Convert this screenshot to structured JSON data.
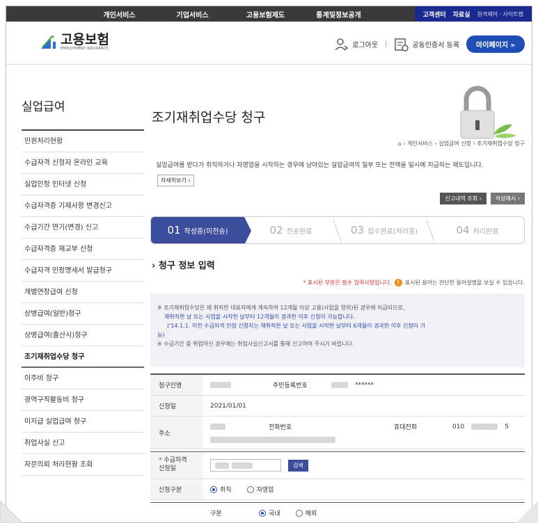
{
  "topnav": {
    "items": [
      "개인서비스",
      "기업서비스",
      "고용보험제도",
      "통계및정보공개"
    ],
    "customer_center": "고객센터",
    "library": "자료실",
    "links": "원격제어 · 사이트맵"
  },
  "header": {
    "logo_title": "고용보험",
    "logo_sub": "EMPLOYMENT INSURANCE",
    "logout": "로그아웃",
    "separator": "|",
    "cert_register": "공동인증서 등록",
    "mypage": "마이페이지  »"
  },
  "sidebar": {
    "title": "실업급여",
    "items": [
      {
        "label": "민원처리현황"
      },
      {
        "label": "수급자격 신청자 온라인 교육"
      },
      {
        "label": "실업인정 인터넷 신청"
      },
      {
        "label": "수급자격증 기재사항 변경신고"
      },
      {
        "label": "수급기간 연기(변경) 신고"
      },
      {
        "label": "수급자격증 재교부 신청"
      },
      {
        "label": "수급자격 인정명세서 발급청구"
      },
      {
        "label": "개별연장급여 신청"
      },
      {
        "label": "상병급여(일반)청구"
      },
      {
        "label": "상병급여(출산시)청구"
      },
      {
        "label": "조기재취업수당 청구"
      },
      {
        "label": "이주비 청구"
      },
      {
        "label": "광역구직활동비 청구"
      },
      {
        "label": "미지급 실업급여 청구"
      },
      {
        "label": "취업사실 신고"
      },
      {
        "label": "자문의뢰 처리현황 조회"
      }
    ],
    "active_index": 10
  },
  "main": {
    "title": "조기재취업수당 청구",
    "breadcrumb": "› 개인서비스 › 실업급여 신청 › 조기재취업수당 청구",
    "description": "실업급여를 받다가 취직하거나 자영업을 시작하는 경우에 남아있는 실업급여의 일부 또는 전액을 일시에 지급하는 제도입니다.",
    "detail_button": "자세히보기 ›",
    "report_button": "신고내역 조회 ›",
    "example_button": "작성예시 ›",
    "steps": [
      {
        "num": "01",
        "label": "작성중(미전송)"
      },
      {
        "num": "02",
        "label": "전송완료"
      },
      {
        "num": "03",
        "label": "접수완료(처리중)"
      },
      {
        "num": "04",
        "label": "처리완료"
      }
    ],
    "section_title": "› 청구 정보 입력",
    "required_note": "* 표시된 부분은 필수 입력사항입니다.",
    "term_note": "표시된 용어는 간단한 용어설명을 보실 수 있습니다.",
    "notice": {
      "line1": "※ 조기재취업수당은 재 취직한 대표자에게 계속하여 12개월 이상 고용(사업을 영위)된 경우에 지급되므로,",
      "line2": "재취직한 날 또는 사업을 시작한 날부터 12개월이 경과한 이후 신청이 가능합니다.",
      "line3": "('14.1.1. 이전 수급자격 인정 신청자는 재취직한 날 또는 사업을 시작한 날부터 6개월이 경과한 이후 신청이 가",
      "line4": "능)",
      "line5": "※ 수급기간 중 취업하신 경우에는 취업사실신고서를 통해 신고하여 주시기 바랍니다."
    },
    "form": {
      "applicant_label": "청구인명",
      "rrn_label": "주민등록번호",
      "rrn_masked": "******",
      "date_label": "신청일",
      "date_value": "2021/01/01",
      "address_label": "주소",
      "phone_label": "전화번호",
      "mobile_label": "휴대전화",
      "mobile_prefix": "010",
      "mobile_suffix": "5",
      "qual_label_req": "*",
      "qual_label": "수급자격\n신청일",
      "search_button": "검색",
      "type_label": "신청구분",
      "type_opt1": "취직",
      "type_opt2": "자영업",
      "division_label": "구분",
      "div_opt1": "국내",
      "div_opt2": "해외"
    }
  }
}
